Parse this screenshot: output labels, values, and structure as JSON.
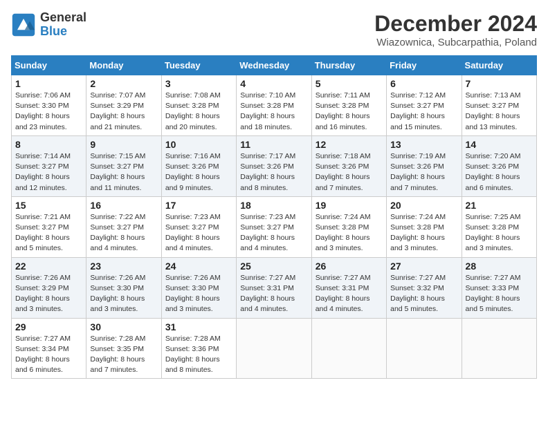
{
  "logo": {
    "line1": "General",
    "line2": "Blue"
  },
  "title": "December 2024",
  "location": "Wiazownica, Subcarpathia, Poland",
  "weekdays": [
    "Sunday",
    "Monday",
    "Tuesday",
    "Wednesday",
    "Thursday",
    "Friday",
    "Saturday"
  ],
  "weeks": [
    [
      {
        "day": "1",
        "info": "Sunrise: 7:06 AM\nSunset: 3:30 PM\nDaylight: 8 hours\nand 23 minutes."
      },
      {
        "day": "2",
        "info": "Sunrise: 7:07 AM\nSunset: 3:29 PM\nDaylight: 8 hours\nand 21 minutes."
      },
      {
        "day": "3",
        "info": "Sunrise: 7:08 AM\nSunset: 3:28 PM\nDaylight: 8 hours\nand 20 minutes."
      },
      {
        "day": "4",
        "info": "Sunrise: 7:10 AM\nSunset: 3:28 PM\nDaylight: 8 hours\nand 18 minutes."
      },
      {
        "day": "5",
        "info": "Sunrise: 7:11 AM\nSunset: 3:28 PM\nDaylight: 8 hours\nand 16 minutes."
      },
      {
        "day": "6",
        "info": "Sunrise: 7:12 AM\nSunset: 3:27 PM\nDaylight: 8 hours\nand 15 minutes."
      },
      {
        "day": "7",
        "info": "Sunrise: 7:13 AM\nSunset: 3:27 PM\nDaylight: 8 hours\nand 13 minutes."
      }
    ],
    [
      {
        "day": "8",
        "info": "Sunrise: 7:14 AM\nSunset: 3:27 PM\nDaylight: 8 hours\nand 12 minutes."
      },
      {
        "day": "9",
        "info": "Sunrise: 7:15 AM\nSunset: 3:27 PM\nDaylight: 8 hours\nand 11 minutes."
      },
      {
        "day": "10",
        "info": "Sunrise: 7:16 AM\nSunset: 3:26 PM\nDaylight: 8 hours\nand 9 minutes."
      },
      {
        "day": "11",
        "info": "Sunrise: 7:17 AM\nSunset: 3:26 PM\nDaylight: 8 hours\nand 8 minutes."
      },
      {
        "day": "12",
        "info": "Sunrise: 7:18 AM\nSunset: 3:26 PM\nDaylight: 8 hours\nand 7 minutes."
      },
      {
        "day": "13",
        "info": "Sunrise: 7:19 AM\nSunset: 3:26 PM\nDaylight: 8 hours\nand 7 minutes."
      },
      {
        "day": "14",
        "info": "Sunrise: 7:20 AM\nSunset: 3:26 PM\nDaylight: 8 hours\nand 6 minutes."
      }
    ],
    [
      {
        "day": "15",
        "info": "Sunrise: 7:21 AM\nSunset: 3:27 PM\nDaylight: 8 hours\nand 5 minutes."
      },
      {
        "day": "16",
        "info": "Sunrise: 7:22 AM\nSunset: 3:27 PM\nDaylight: 8 hours\nand 4 minutes."
      },
      {
        "day": "17",
        "info": "Sunrise: 7:23 AM\nSunset: 3:27 PM\nDaylight: 8 hours\nand 4 minutes."
      },
      {
        "day": "18",
        "info": "Sunrise: 7:23 AM\nSunset: 3:27 PM\nDaylight: 8 hours\nand 4 minutes."
      },
      {
        "day": "19",
        "info": "Sunrise: 7:24 AM\nSunset: 3:28 PM\nDaylight: 8 hours\nand 3 minutes."
      },
      {
        "day": "20",
        "info": "Sunrise: 7:24 AM\nSunset: 3:28 PM\nDaylight: 8 hours\nand 3 minutes."
      },
      {
        "day": "21",
        "info": "Sunrise: 7:25 AM\nSunset: 3:28 PM\nDaylight: 8 hours\nand 3 minutes."
      }
    ],
    [
      {
        "day": "22",
        "info": "Sunrise: 7:26 AM\nSunset: 3:29 PM\nDaylight: 8 hours\nand 3 minutes."
      },
      {
        "day": "23",
        "info": "Sunrise: 7:26 AM\nSunset: 3:30 PM\nDaylight: 8 hours\nand 3 minutes."
      },
      {
        "day": "24",
        "info": "Sunrise: 7:26 AM\nSunset: 3:30 PM\nDaylight: 8 hours\nand 3 minutes."
      },
      {
        "day": "25",
        "info": "Sunrise: 7:27 AM\nSunset: 3:31 PM\nDaylight: 8 hours\nand 4 minutes."
      },
      {
        "day": "26",
        "info": "Sunrise: 7:27 AM\nSunset: 3:31 PM\nDaylight: 8 hours\nand 4 minutes."
      },
      {
        "day": "27",
        "info": "Sunrise: 7:27 AM\nSunset: 3:32 PM\nDaylight: 8 hours\nand 5 minutes."
      },
      {
        "day": "28",
        "info": "Sunrise: 7:27 AM\nSunset: 3:33 PM\nDaylight: 8 hours\nand 5 minutes."
      }
    ],
    [
      {
        "day": "29",
        "info": "Sunrise: 7:27 AM\nSunset: 3:34 PM\nDaylight: 8 hours\nand 6 minutes."
      },
      {
        "day": "30",
        "info": "Sunrise: 7:28 AM\nSunset: 3:35 PM\nDaylight: 8 hours\nand 7 minutes."
      },
      {
        "day": "31",
        "info": "Sunrise: 7:28 AM\nSunset: 3:36 PM\nDaylight: 8 hours\nand 8 minutes."
      },
      null,
      null,
      null,
      null
    ]
  ]
}
